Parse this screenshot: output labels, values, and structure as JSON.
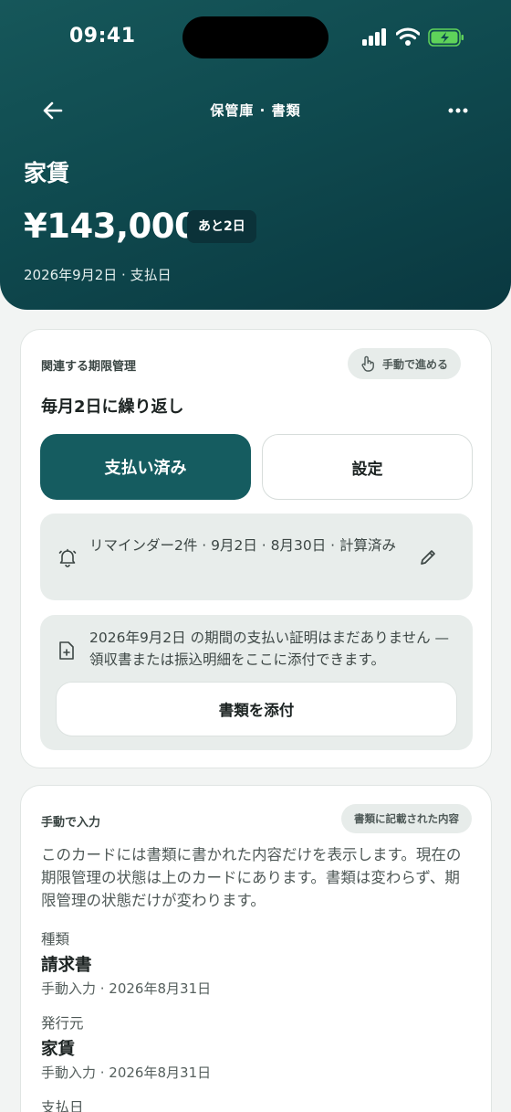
{
  "status_bar": {
    "time": "09:41"
  },
  "nav": {
    "title": "保管庫 · 書類"
  },
  "hero": {
    "title": "家賃",
    "amount": "¥143,000",
    "badge": "あと2日",
    "due_line": "2026年9月2日 · 支払日"
  },
  "deadline_card": {
    "label": "関連する期限管理",
    "manual_chip": "手動で進める",
    "recurrence": "毎月2日に繰り返し",
    "paid_button": "支払い済み",
    "settings_button": "設定",
    "reminder_text": "リマインダー2件 · 9月2日 · 8月30日 · 計算済み",
    "attach_text": "2026年9月2日 の期間の支払い証明はまだありません — 領収書または振込明細をここに添付できます。",
    "attach_button": "書類を添付"
  },
  "manual_card": {
    "label": "手動で入力",
    "chip": "書類に記載された内容",
    "description": "このカードには書類に書かれた内容だけを表示します。現在の期限管理の状態は上のカードにあります。書類は変わらず、期限管理の状態だけが変わります。",
    "fields": [
      {
        "label": "種類",
        "value": "請求書",
        "meta": "手動入力 · 2026年8月31日"
      },
      {
        "label": "発行元",
        "value": "家賃",
        "meta": "手動入力 · 2026年8月31日"
      },
      {
        "label": "支払日",
        "value": "",
        "meta": ""
      }
    ]
  },
  "colors": {
    "accent": "#155c60",
    "header_dark": "#0a3840",
    "battery_fill": "#5fd35a"
  },
  "icons": [
    "back-arrow-icon",
    "more-icon",
    "signal-icon",
    "wifi-icon",
    "battery-icon",
    "touch-icon",
    "bell-icon",
    "pencil-icon",
    "document-add-icon"
  ]
}
